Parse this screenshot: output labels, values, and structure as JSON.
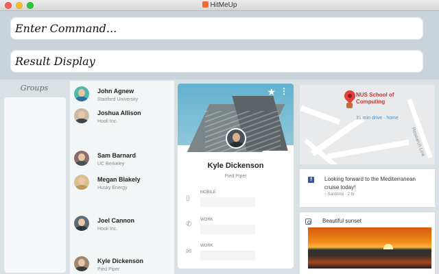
{
  "window": {
    "title": "HitMeUp"
  },
  "command": {
    "placeholder": "Enter Command..."
  },
  "result": {
    "text": "Result Display"
  },
  "groups": {
    "title": "Groups"
  },
  "people": [
    {
      "name": "John Agnew",
      "org": "Stanford University"
    },
    {
      "name": "Joshua Allison",
      "org": "Hooli Inc."
    },
    {
      "name": "Sam Barnard",
      "org": "UC Berkeley"
    },
    {
      "name": "Megan Blakely",
      "org": "Husky Energy"
    },
    {
      "name": "Joel Cannon",
      "org": "Hooli Inc."
    },
    {
      "name": "Kyle Dickenson",
      "org": "Pied Piper"
    }
  ],
  "profile": {
    "name": "Kyle Dickenson",
    "org": "Pied Piper",
    "fields": [
      {
        "label": "MOBILE",
        "icon": "phone-icon"
      },
      {
        "label": "WORK",
        "icon": "call-icon"
      },
      {
        "label": "WORK",
        "icon": "mail-icon"
      }
    ]
  },
  "map": {
    "place": "NUS School of Computing",
    "drive": "31 min drive · home",
    "road_label": "Research Link"
  },
  "facebook": {
    "post": "Looking forward to the Mediterranean cruise today!",
    "meta": "↑ Santorini · 2 hr"
  },
  "instagram": {
    "title": "Beautiful sunset"
  },
  "colors": {
    "facebook": "#3b5998",
    "instagram": "#3f729b",
    "pin": "#e2403b"
  }
}
